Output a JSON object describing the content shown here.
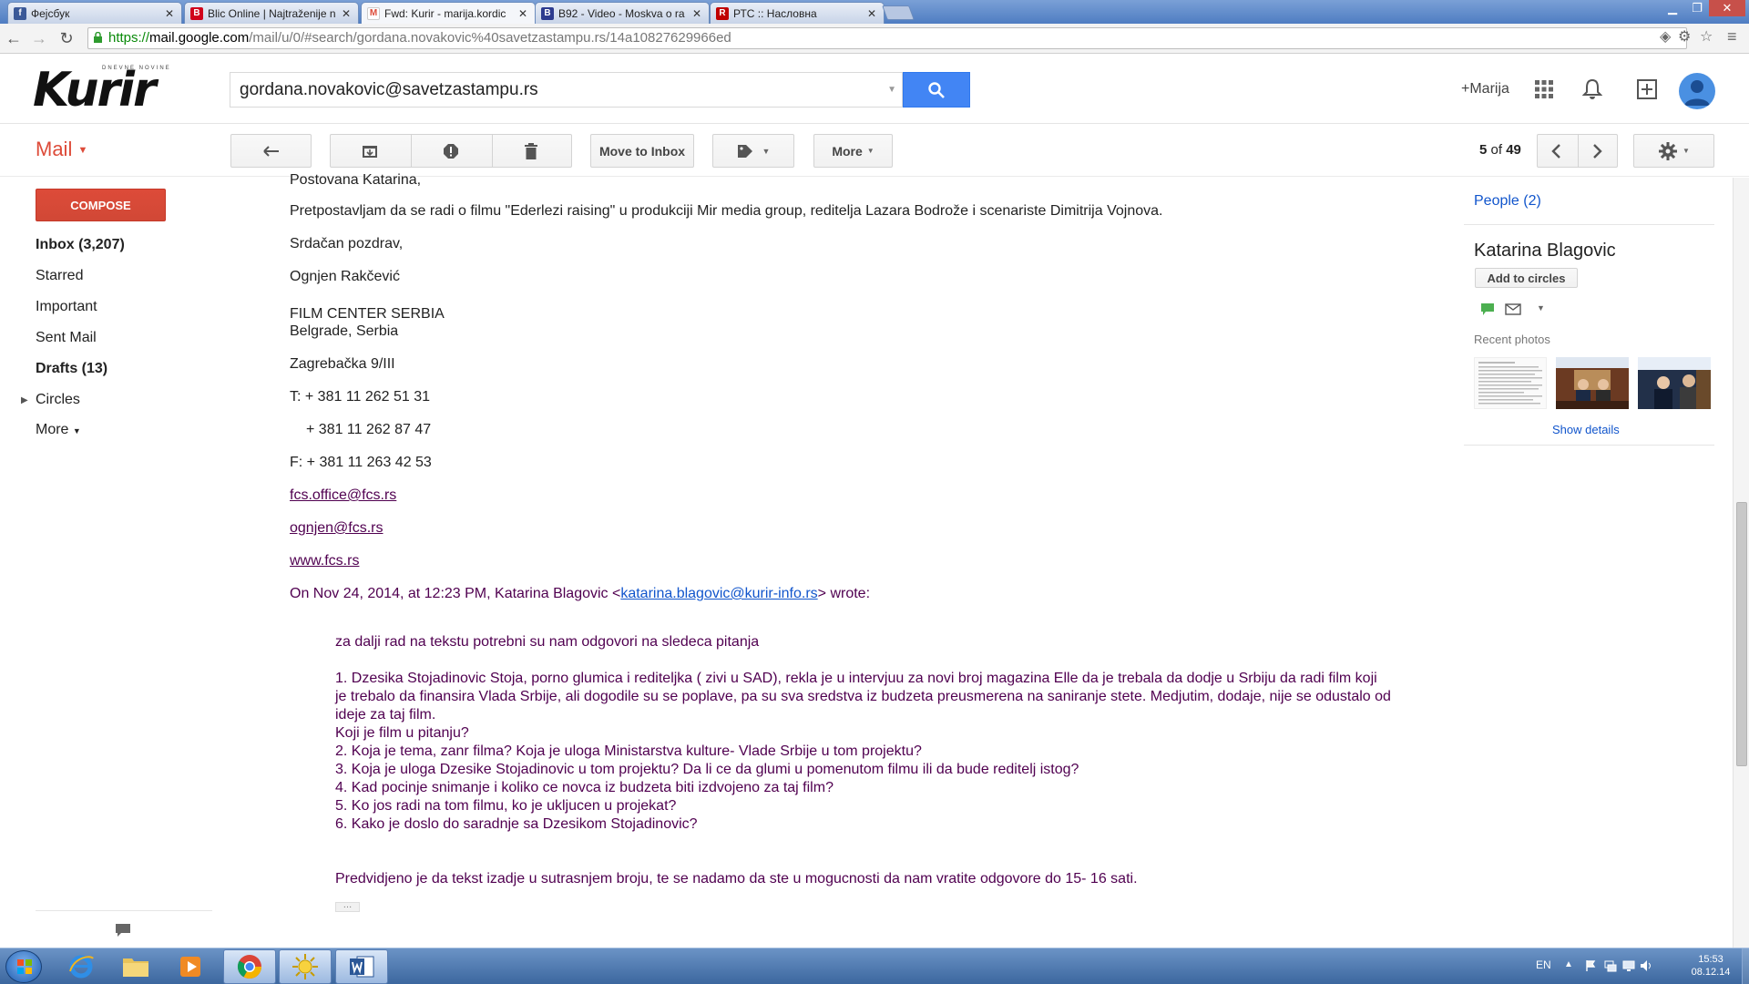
{
  "browser": {
    "tabs": [
      {
        "title": "Фејсбук",
        "icon": "facebook-icon",
        "color": "#3b5998"
      },
      {
        "title": "Blic Online | Najtraženije n",
        "icon": "blic-icon",
        "color": "#d0021b"
      },
      {
        "title": "Fwd: Kurir - marija.kordic",
        "icon": "gmail-icon",
        "color": "#dd4b39",
        "active": true
      },
      {
        "title": "B92 - Video - Moskva o ra",
        "icon": "b92-icon",
        "color": "#2d3b8f"
      },
      {
        "title": "РТС :: Насловна",
        "icon": "rts-icon",
        "color": "#c00000"
      }
    ],
    "url_protocol": "https://",
    "url_host": "mail.google.com",
    "url_path": "/mail/u/0/#search/gordana.novakovic%40savetzastampu.rs/14a10827629966ed"
  },
  "header": {
    "logo_text": "Kurir",
    "logo_tagline": "DNEVNE NOVINE",
    "search_value": "gordana.novakovic@savetzastampu.rs",
    "user_label": "+Marija"
  },
  "actions": {
    "mail_label": "Mail",
    "move_to_inbox": "Move to Inbox",
    "more": "More",
    "page_current": "5",
    "page_of": "of",
    "page_total": "49"
  },
  "nav": {
    "compose": "COMPOSE",
    "inbox": "Inbox (3,207)",
    "starred": "Starred",
    "important": "Important",
    "sent": "Sent Mail",
    "drafts": "Drafts (13)",
    "circles": "Circles",
    "more": "More"
  },
  "message": {
    "greeting": "Postovana Katarina,",
    "body_line": "Pretpostavljam da se radi o filmu \"Ederlezi raising\" u produkciji Mir media group, reditelja Lazara Bodrože i scenariste Dimitrija Vojnova.",
    "closing": "Srdačan pozdrav,",
    "sender": "Ognjen Rakčević",
    "org": "FILM CENTER SERBIA",
    "city": "Belgrade, Serbia",
    "street": "Zagrebačka 9/III",
    "phone1": "T: + 381 11 262 51 31",
    "phone2": "+ 381 11 262 87 47",
    "fax": "F: + 381 11 263 42 53",
    "email1": "fcs.office@fcs.rs",
    "email2": "ognjen@fcs.rs",
    "website": "www.fcs.rs",
    "quote_header_pre": "On Nov 24, 2014, at 12:23 PM, Katarina Blagovic <",
    "quote_header_email": "katarina.blagovic@kurir-info.rs",
    "quote_header_post": "> wrote:",
    "quote_intro": "za dalji rad na tekstu potrebni su nam odgovori na sledeca pitanja",
    "q1": "1. Dzesika Stojadinovic Stoja, porno glumica i rediteljka ( zivi u SAD),  rekla je u intervjuu za novi broj magazina Elle da je trebala da dodje u Srbiju da radi film koji je trebalo da finansira Vlada Srbije, ali dogodile su se poplave, pa su sva sredstva iz budzeta preusmerena na saniranje stete. Medjutim, dodaje, nije se odustalo od ideje za taj film.",
    "q1b": "Koji je film u pitanju?",
    "q2": "2. Koja je tema, zanr filma? Koja je uloga Ministarstva kulture- Vlade Srbije u tom projektu?",
    "q3": "3. Koja je uloga Dzesike Stojadinovic u tom projektu? Da li ce da glumi u pomenutom filmu ili da bude reditelj istog?",
    "q4": "4. Kad pocinje snimanje i koliko ce novca iz budzeta biti izdvojeno za taj film?",
    "q5": "5. Ko jos radi na tom filmu, ko je ukljucen u projekat?",
    "q6": "6. Kako je doslo do saradnje sa Dzesikom Stojadinovic?",
    "quote_closing": "Predvidjeno je da tekst izadje u sutrasnjem broju, te se nadamo da ste u mogucnosti da nam vratite odgovore do 15- 16 sati."
  },
  "people": {
    "link": "People (2)",
    "name": "Katarina Blagovic",
    "add_to_circles": "Add to circles",
    "recent_photos": "Recent photos",
    "show_details": "Show details"
  },
  "taskbar": {
    "lang": "EN",
    "time": "15:53",
    "date": "08.12.14"
  },
  "colors": {
    "gmail_red": "#dd4b39",
    "search_blue": "#4285f4",
    "link_blue": "#1155cc",
    "quote_purple": "#500050"
  }
}
